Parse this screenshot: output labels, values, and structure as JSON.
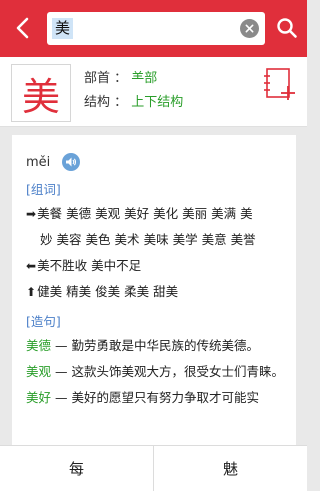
{
  "header": {
    "back_icon": "chevron-left-icon",
    "search_value": "美",
    "clear_icon": "clear-icon",
    "search_icon": "search-icon"
  },
  "character": {
    "glyph": "美",
    "radical_label": "部首 ：",
    "radical_value": "⺷部",
    "structure_label": "结构 ：",
    "structure_value": "上下结构",
    "add_icon": "add-to-notebook-icon"
  },
  "pronunciation": {
    "pinyin": "měi",
    "audio_icon": "speaker-icon"
  },
  "words": {
    "title": "[组词]",
    "groups": [
      {
        "marker": "➡",
        "lines": [
          [
            "美餐",
            "美德",
            "美观",
            "美好",
            "美化",
            "美丽",
            "美满",
            "美"
          ],
          [
            "妙",
            "美容",
            "美色",
            "美术",
            "美味",
            "美学",
            "美意",
            "美誉"
          ]
        ]
      },
      {
        "marker": "⬅",
        "lines": [
          [
            "美不胜收",
            "美中不足"
          ]
        ]
      },
      {
        "marker": "⬆",
        "lines": [
          [
            "健美",
            "精美",
            "俊美",
            "柔美",
            "甜美"
          ]
        ]
      }
    ]
  },
  "sentences": {
    "title": "[造句]",
    "items": [
      {
        "word": "美德",
        "text": " — 勤劳勇敢是中华民族的传统美德。"
      },
      {
        "word": "美观",
        "text": " — 这款头饰美观大方，很受女士们青睐。"
      },
      {
        "word": "美好",
        "text": " — 美好的愿望只有努力争取才可能实"
      }
    ]
  },
  "footer": {
    "prev_label": "每",
    "next_label": "魅"
  },
  "colors": {
    "accent": "#e02f3b",
    "link": "#4b7fc8",
    "green": "#2a9e2a"
  }
}
